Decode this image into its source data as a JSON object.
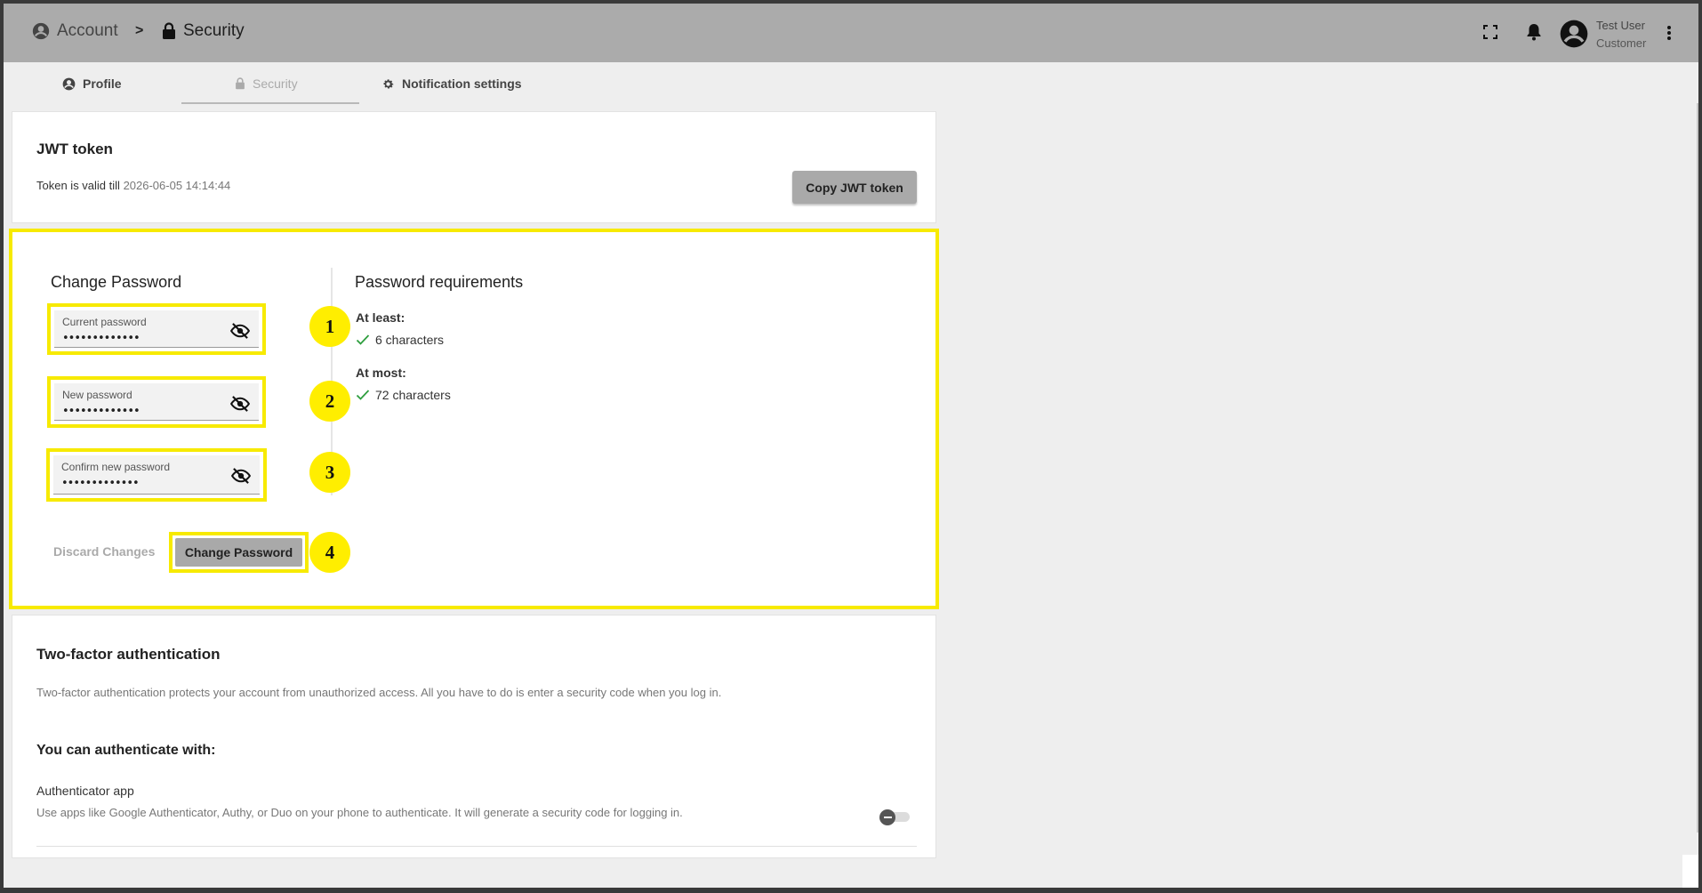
{
  "header": {
    "breadcrumb_account": "Account",
    "breadcrumb_separator": ">",
    "breadcrumb_security": "Security",
    "user_name": "Test User",
    "user_role": "Customer"
  },
  "tabs": [
    {
      "label": "Profile",
      "icon": "account-circle-icon"
    },
    {
      "label": "Security",
      "icon": "lock-icon"
    },
    {
      "label": "Notification settings",
      "icon": "gear-icon"
    }
  ],
  "jwt": {
    "title": "JWT token",
    "valid_label": "Token is valid till",
    "valid_date": "2026-06-05 14:14:44",
    "copy_button": "Copy JWT token"
  },
  "change_password": {
    "title": "Change Password",
    "fields": [
      {
        "label": "Current password",
        "value": "•••••••••••••",
        "marker": "1"
      },
      {
        "label": "New password",
        "value": "•••••••••••••",
        "marker": "2"
      },
      {
        "label": "Confirm new password",
        "value": "•••••••••••••",
        "marker": "3"
      }
    ],
    "discard_button": "Discard Changes",
    "change_button": "Change Password",
    "change_marker": "4"
  },
  "requirements": {
    "title": "Password requirements",
    "at_least_label": "At least:",
    "at_least_item": "6 characters",
    "at_most_label": "At most:",
    "at_most_item": "72 characters",
    "check_color": "#2e9e3e"
  },
  "two_factor": {
    "title": "Two-factor authentication",
    "description": "Two-factor authentication protects your account from unauthorized access. All you have to do is enter a security code when you log in.",
    "subtitle": "You can authenticate with:",
    "app_title": "Authenticator app",
    "app_description": "Use apps like Google Authenticator, Authy, or Duo on your phone to authenticate. It will generate a security code for logging in."
  },
  "colors": {
    "highlight": "#f7ea00",
    "header_bg": "#ababab",
    "button_bg": "#a9a9a9"
  }
}
